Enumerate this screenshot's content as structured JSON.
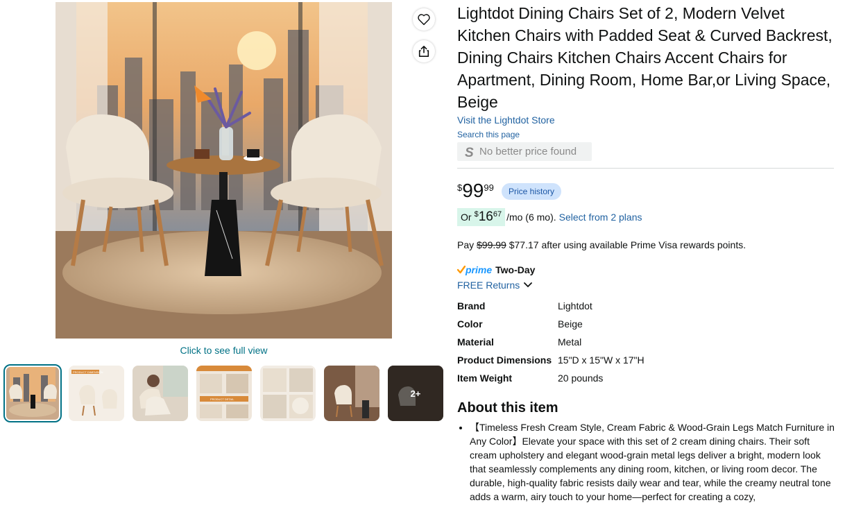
{
  "product": {
    "title": "Lightdot Dining Chairs Set of 2, Modern Velvet Kitchen Chairs with Padded Seat & Curved Backrest, Dining Chairs Kitchen Chairs Accent Chairs for Apartment, Dining Room, Home Bar,or Living Space, Beige",
    "store_link": "Visit the Lightdot Store",
    "search_page": "Search this page",
    "better_price": "No better price found"
  },
  "gallery": {
    "full_view_link": "Click to see full view",
    "more_label": "2+",
    "thumb_labels": [
      "PRODUCT DIMENSION",
      "PRODUCT DETAIL"
    ]
  },
  "pricing": {
    "currency": "$",
    "whole": "99",
    "fraction": "99",
    "price_history": "Price history",
    "monthly_prefix": "Or",
    "monthly_whole": "16",
    "monthly_fraction": "67",
    "monthly_suffix": "/mo (6 mo).",
    "plans_link": "Select from 2 plans",
    "pay_prefix": "Pay",
    "pay_original": "$99.99",
    "pay_rest": "$77.17 after using available Prime Visa rewards points."
  },
  "shipping": {
    "prime": "prime",
    "two_day": "Two-Day",
    "returns": "FREE Returns"
  },
  "specs": [
    {
      "key": "Brand",
      "value": "Lightdot"
    },
    {
      "key": "Color",
      "value": "Beige"
    },
    {
      "key": "Material",
      "value": "Metal"
    },
    {
      "key": "Product Dimensions",
      "value": "15\"D x 15\"W x 17\"H"
    },
    {
      "key": "Item Weight",
      "value": "20 pounds"
    }
  ],
  "about": {
    "heading": "About this item",
    "bullet1": "【Timeless Fresh Cream Style, Cream Fabric & Wood-Grain Legs Match Furniture in Any Color】Elevate your space with this set of 2 cream dining chairs. Their soft cream upholstery and elegant wood-grain metal legs deliver a bright, modern look that seamlessly complements any dining room, kitchen, or living room decor. The durable, high-quality fabric resists daily wear and tear, while the creamy neutral tone adds a warm, airy touch to your home—perfect for creating a cozy,"
  },
  "icons": {
    "wishlist": "heart-icon",
    "share": "share-icon",
    "chevron": "chevron-down-icon",
    "check": "check-icon",
    "price_tracker": "price-tracker-icon"
  },
  "colors": {
    "link": "#2162a1",
    "teal": "#007185",
    "prime_blue": "#1a98ff",
    "check_orange": "#ff9900"
  }
}
